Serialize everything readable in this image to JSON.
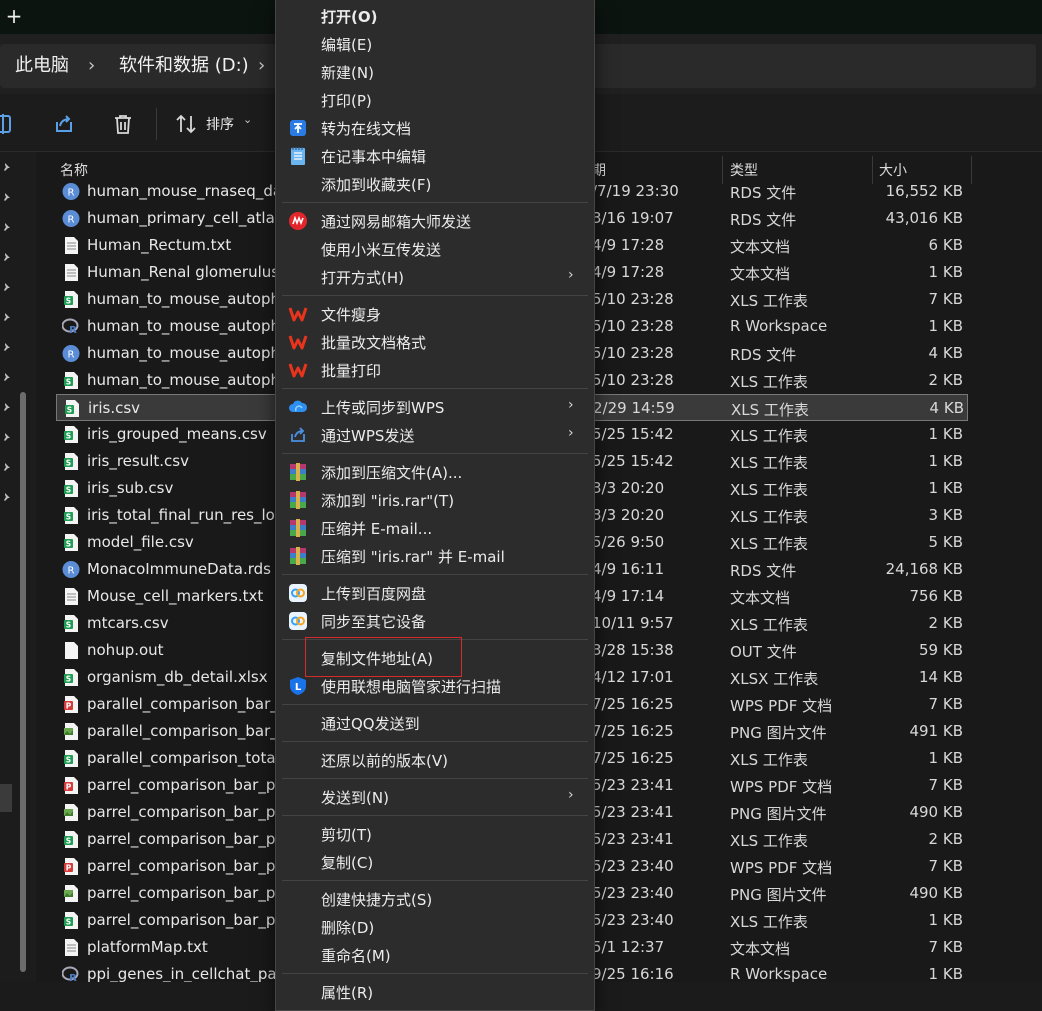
{
  "titlebar": {
    "new_tab": "+"
  },
  "breadcrumb": [
    {
      "label": "此电脑"
    },
    {
      "label": "软件和数据 (D:)"
    }
  ],
  "breadcrumb_sep": "›",
  "toolbar": {
    "sort_label": "排序",
    "sort_chevron": "⌄"
  },
  "columns": {
    "name": "名称",
    "date": "期",
    "type": "类型",
    "size": "大小"
  },
  "files": [
    {
      "name": "human_mouse_rnaseq_da",
      "date": "/7/19 23:30",
      "type": "RDS 文件",
      "size": "16,552 KB",
      "icon": "rds"
    },
    {
      "name": "human_primary_cell_atlas.",
      "date": "3/16 19:07",
      "type": "RDS 文件",
      "size": "43,016 KB",
      "icon": "rds"
    },
    {
      "name": "Human_Rectum.txt",
      "date": "4/9 17:28",
      "type": "文本文档",
      "size": "6 KB",
      "icon": "txt"
    },
    {
      "name": "Human_Renal glomerulus.",
      "date": "4/9 17:28",
      "type": "文本文档",
      "size": "1 KB",
      "icon": "txt"
    },
    {
      "name": "human_to_mouse_autopha",
      "date": "5/10 23:28",
      "type": "XLS 工作表",
      "size": "7 KB",
      "icon": "xls"
    },
    {
      "name": "human_to_mouse_autopha",
      "date": "5/10 23:28",
      "type": "R Workspace",
      "size": "1 KB",
      "icon": "r"
    },
    {
      "name": "human_to_mouse_autopha",
      "date": "5/10 23:28",
      "type": "RDS 文件",
      "size": "4 KB",
      "icon": "rds"
    },
    {
      "name": "human_to_mouse_autopha",
      "date": "5/10 23:28",
      "type": "XLS 工作表",
      "size": "2 KB",
      "icon": "xls"
    },
    {
      "name": "iris.csv",
      "date": "2/29 14:59",
      "type": "XLS 工作表",
      "size": "4 KB",
      "icon": "xls",
      "selected": true
    },
    {
      "name": "iris_grouped_means.csv",
      "date": "5/25 15:42",
      "type": "XLS 工作表",
      "size": "1 KB",
      "icon": "xls"
    },
    {
      "name": "iris_result.csv",
      "date": "5/25 15:42",
      "type": "XLS 工作表",
      "size": "1 KB",
      "icon": "xls"
    },
    {
      "name": "iris_sub.csv",
      "date": "3/3 20:20",
      "type": "XLS 工作表",
      "size": "1 KB",
      "icon": "xls"
    },
    {
      "name": "iris_total_final_run_res_log",
      "date": "3/3 20:20",
      "type": "XLS 工作表",
      "size": "3 KB",
      "icon": "xls"
    },
    {
      "name": "model_file.csv",
      "date": "5/26 9:50",
      "type": "XLS 工作表",
      "size": "5 KB",
      "icon": "xls"
    },
    {
      "name": "MonacoImmuneData.rds",
      "date": "4/9 16:11",
      "type": "RDS 文件",
      "size": "24,168 KB",
      "icon": "rds"
    },
    {
      "name": "Mouse_cell_markers.txt",
      "date": "4/9 17:14",
      "type": "文本文档",
      "size": "756 KB",
      "icon": "txt"
    },
    {
      "name": "mtcars.csv",
      "date": "10/11 9:57",
      "type": "XLS 工作表",
      "size": "2 KB",
      "icon": "xls"
    },
    {
      "name": "nohup.out",
      "date": "3/28 15:38",
      "type": "OUT 文件",
      "size": "59 KB",
      "icon": "blank"
    },
    {
      "name": "organism_db_detail.xlsx",
      "date": "4/12 17:01",
      "type": "XLSX 工作表",
      "size": "14 KB",
      "icon": "xlsx"
    },
    {
      "name": "parallel_comparison_bar_p",
      "date": "7/25 16:25",
      "type": "WPS PDF 文档",
      "size": "7 KB",
      "icon": "pdf"
    },
    {
      "name": "parallel_comparison_bar_p",
      "date": "7/25 16:25",
      "type": "PNG 图片文件",
      "size": "491 KB",
      "icon": "png"
    },
    {
      "name": "parallel_comparison_total_",
      "date": "7/25 16:25",
      "type": "XLS 工作表",
      "size": "1 KB",
      "icon": "xls"
    },
    {
      "name": "parrel_comparison_bar_pl",
      "date": "5/23 23:41",
      "type": "WPS PDF 文档",
      "size": "7 KB",
      "icon": "pdf"
    },
    {
      "name": "parrel_comparison_bar_pl",
      "date": "5/23 23:41",
      "type": "PNG 图片文件",
      "size": "490 KB",
      "icon": "png"
    },
    {
      "name": "parrel_comparison_bar_pl",
      "date": "5/23 23:41",
      "type": "XLS 工作表",
      "size": "2 KB",
      "icon": "xls"
    },
    {
      "name": "parrel_comparison_bar_pl",
      "date": "5/23 23:40",
      "type": "WPS PDF 文档",
      "size": "7 KB",
      "icon": "pdf"
    },
    {
      "name": "parrel_comparison_bar_pl",
      "date": "5/23 23:40",
      "type": "PNG 图片文件",
      "size": "490 KB",
      "icon": "png"
    },
    {
      "name": "parrel_comparison_bar_pl",
      "date": "5/23 23:40",
      "type": "XLS 工作表",
      "size": "1 KB",
      "icon": "xls"
    },
    {
      "name": "platformMap.txt",
      "date": "5/1 12:37",
      "type": "文本文档",
      "size": "7 KB",
      "icon": "txt"
    },
    {
      "name": "ppi_genes_in_cellchat_pat",
      "date": "9/25 16:16",
      "type": "R Workspace",
      "size": "1 KB",
      "icon": "r"
    }
  ],
  "context_menu": [
    {
      "label": "打开(O)",
      "bold": true
    },
    {
      "label": "编辑(E)"
    },
    {
      "label": "新建(N)"
    },
    {
      "label": "打印(P)"
    },
    {
      "label": "转为在线文档",
      "icon": "online-doc-icon"
    },
    {
      "label": "在记事本中编辑",
      "icon": "notepad-icon"
    },
    {
      "label": "添加到收藏夹(F)"
    },
    {
      "sep": true
    },
    {
      "label": "通过网易邮箱大师发送",
      "icon": "netease-mail-icon"
    },
    {
      "label": "使用小米互传发送"
    },
    {
      "label": "打开方式(H)",
      "submenu": true
    },
    {
      "sep": true
    },
    {
      "label": "文件瘦身",
      "icon": "wps-icon"
    },
    {
      "label": "批量改文档格式",
      "icon": "wps-icon"
    },
    {
      "label": "批量打印",
      "icon": "wps-icon"
    },
    {
      "sep": true
    },
    {
      "label": "上传或同步到WPS",
      "icon": "wps-cloud-icon",
      "submenu": true
    },
    {
      "label": "通过WPS发送",
      "icon": "share-icon",
      "submenu": true
    },
    {
      "sep": true
    },
    {
      "label": "添加到压缩文件(A)...",
      "icon": "winrar-icon"
    },
    {
      "label": "添加到 \"iris.rar\"(T)",
      "icon": "winrar-icon"
    },
    {
      "label": "压缩并 E-mail...",
      "icon": "winrar-icon"
    },
    {
      "label": "压缩到 \"iris.rar\" 并 E-mail",
      "icon": "winrar-icon"
    },
    {
      "sep": true
    },
    {
      "label": "上传到百度网盘",
      "icon": "baidu-netdisk-icon"
    },
    {
      "label": "同步至其它设备",
      "icon": "baidu-netdisk-icon"
    },
    {
      "sep": true
    },
    {
      "label": "复制文件地址(A)"
    },
    {
      "label": "使用联想电脑管家进行扫描",
      "icon": "lenovo-shield-icon"
    },
    {
      "sep": true
    },
    {
      "label": "通过QQ发送到"
    },
    {
      "sep": true
    },
    {
      "label": "还原以前的版本(V)"
    },
    {
      "sep": true
    },
    {
      "label": "发送到(N)",
      "submenu": true
    },
    {
      "sep": true
    },
    {
      "label": "剪切(T)"
    },
    {
      "label": "复制(C)"
    },
    {
      "sep": true
    },
    {
      "label": "创建快捷方式(S)"
    },
    {
      "label": "删除(D)"
    },
    {
      "label": "重命名(M)"
    },
    {
      "sep": true
    },
    {
      "label": "属性(R)"
    }
  ],
  "colors": {
    "xls_green": "#1f9d55",
    "rds_blue": "#5b8dd6",
    "pdf_red": "#d63b3b",
    "wps_red": "#e8341c",
    "highlight_red": "#d42b2b"
  }
}
